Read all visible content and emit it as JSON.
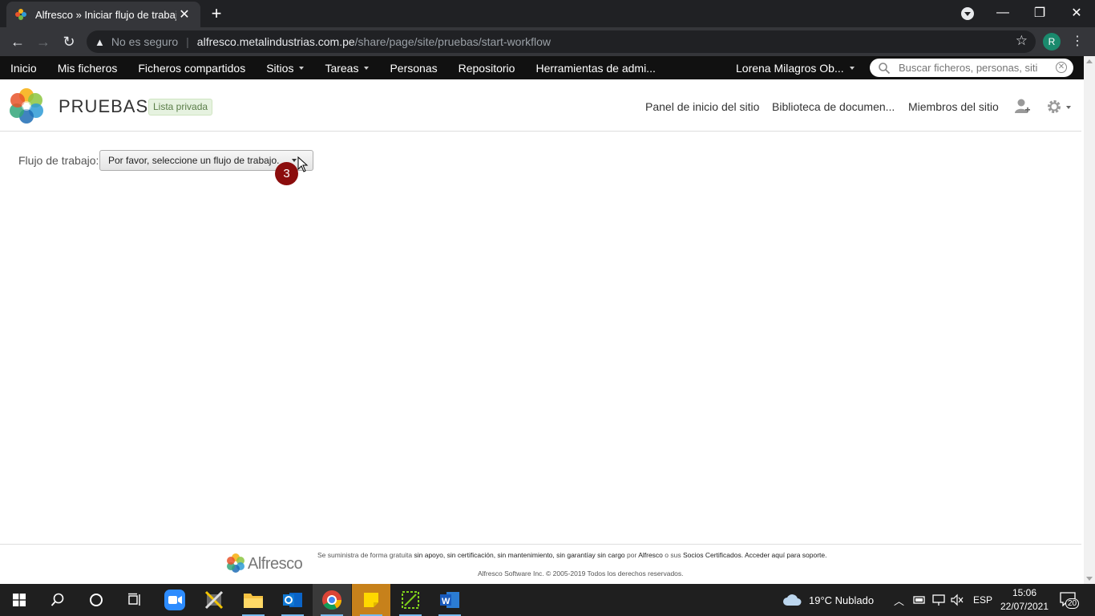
{
  "browser": {
    "tab_title": "Alfresco » Iniciar flujo de trabajo",
    "security_label": "No es seguro",
    "url_host": "alfresco.metalindustrias.com.pe",
    "url_path": "/share/page/site/pruebas/start-workflow",
    "profile_initial": "R"
  },
  "app_nav": {
    "items": [
      "Inicio",
      "Mis ficheros",
      "Ficheros compartidos",
      "Sitios",
      "Tareas",
      "Personas",
      "Repositorio",
      "Herramientas de admi..."
    ],
    "user_name": "Lorena Milagros Ob...",
    "search_placeholder": "Buscar ficheros, personas, siti"
  },
  "site": {
    "name": "PRUEBAS",
    "visibility_badge": "Lista privada",
    "nav": [
      "Panel de inicio del sitio",
      "Biblioteca de documen...",
      "Miembros del sitio"
    ]
  },
  "workflow": {
    "label": "Flujo de trabajo:",
    "select_value": "Por favor, seleccione un flujo de trabajo.",
    "step_number": "3"
  },
  "footer": {
    "brand": "Alfresco",
    "line1_a": "Se suministra de forma gratuita ",
    "line1_b": "sin apoyo, sin certificación, sin mantenimiento, sin garantíay sin cargo",
    "line1_c": " por ",
    "line1_d": "Alfresco",
    "line1_e": " o sus ",
    "line1_f": "Socios Certificados. Acceder aquí para soporte.",
    "line2": "Alfresco Software Inc. © 2005-2019 Todos los derechos reservados."
  },
  "taskbar": {
    "weather": "19°C  Nublado",
    "language": "ESP",
    "time": "15:06",
    "date": "22/07/2021",
    "notifications": "20"
  },
  "colors": {
    "app_bar": "#111111",
    "step_badge": "#8b0d0d",
    "private_badge_bg": "#e6f2e0"
  }
}
